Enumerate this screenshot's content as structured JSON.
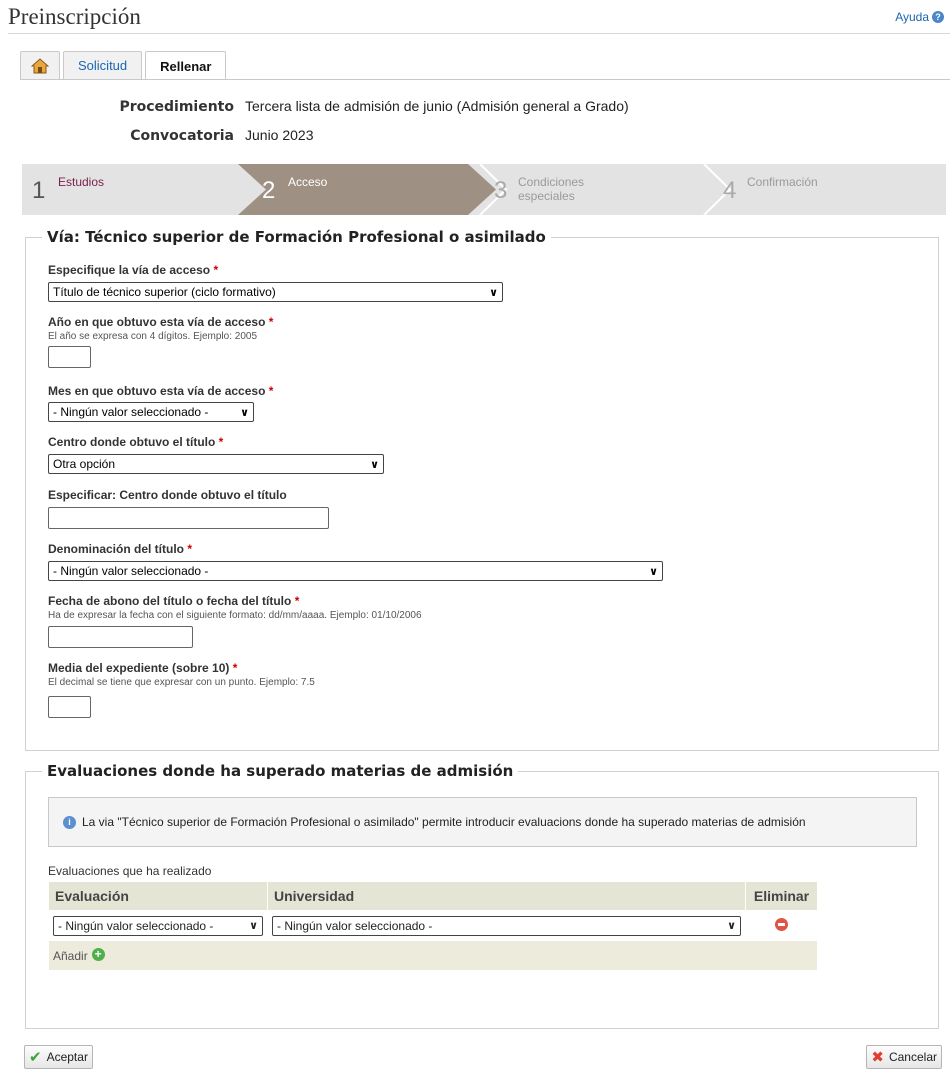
{
  "header": {
    "title": "Preinscripción",
    "help_label": "Ayuda"
  },
  "tabs": [
    {
      "label": ""
    },
    {
      "label": "Solicitud"
    },
    {
      "label": "Rellenar"
    }
  ],
  "info": {
    "procedimiento_label": "Procedimiento",
    "procedimiento_value": "Tercera lista de admisión de junio (Admisión general a Grado)",
    "convocatoria_label": "Convocatoria",
    "convocatoria_value": "Junio 2023"
  },
  "steps": [
    {
      "num": "1",
      "label": "Estudios",
      "state": "done",
      "color": "#7a1f4a"
    },
    {
      "num": "2",
      "label": "Acceso",
      "state": "active",
      "color": "#ffffff"
    },
    {
      "num": "3",
      "label": "Condiciones especiales",
      "state": "pending",
      "color": "#9a9a9a"
    },
    {
      "num": "4",
      "label": "Confirmación",
      "state": "pending",
      "color": "#9a9a9a"
    }
  ],
  "colors": {
    "active_step": "#9e9082",
    "table_header": "#e5e5d5",
    "link": "#1a66b3"
  },
  "via": {
    "legend": "Vía: Técnico superior de Formación Profesional o asimilado",
    "via_acceso_label": "Especifique la vía de acceso",
    "via_acceso_value": "Título de técnico superior (ciclo formativo)",
    "anio_label": "Año en que obtuvo esta vía de acceso",
    "anio_hint": "El año se expresa con 4 dígitos. Ejemplo: 2005",
    "anio_value": "",
    "mes_label": "Mes en que obtuvo esta vía de acceso",
    "mes_value": "- Ningún valor seleccionado -",
    "centro_label": "Centro donde obtuvo el título",
    "centro_value": "Otra opción",
    "especificar_label": "Especificar: Centro donde obtuvo el título",
    "especificar_value": "",
    "denominacion_label": "Denominación del título",
    "denominacion_value": "- Ningún valor seleccionado -",
    "fecha_label": "Fecha de abono del título o fecha del título",
    "fecha_hint": "Ha de expresar la fecha con el siguiente formato: dd/mm/aaaa. Ejemplo: 01/10/2006",
    "fecha_value": "",
    "media_label": "Media del expediente (sobre 10)",
    "media_hint": "El decimal se tiene que expresar con un punto. Ejemplo: 7.5",
    "media_value": "",
    "required_mark": "*"
  },
  "eval": {
    "legend": "Evaluaciones donde ha superado materias de admisión",
    "notice": "La via \"Técnico superior de Formación Profesional o asimilado\" permite introducir evaluacions donde ha superado materias de admisión",
    "table_caption": "Evaluaciones que ha realizado",
    "columns": [
      "Evaluación",
      "Universidad",
      "Eliminar"
    ],
    "rows": [
      {
        "evaluacion": "- Ningún valor seleccionado -",
        "universidad": "- Ningún valor seleccionado -"
      }
    ],
    "add_label": "Añadir"
  },
  "footer": {
    "accept_label": "Aceptar",
    "cancel_label": "Cancelar"
  }
}
